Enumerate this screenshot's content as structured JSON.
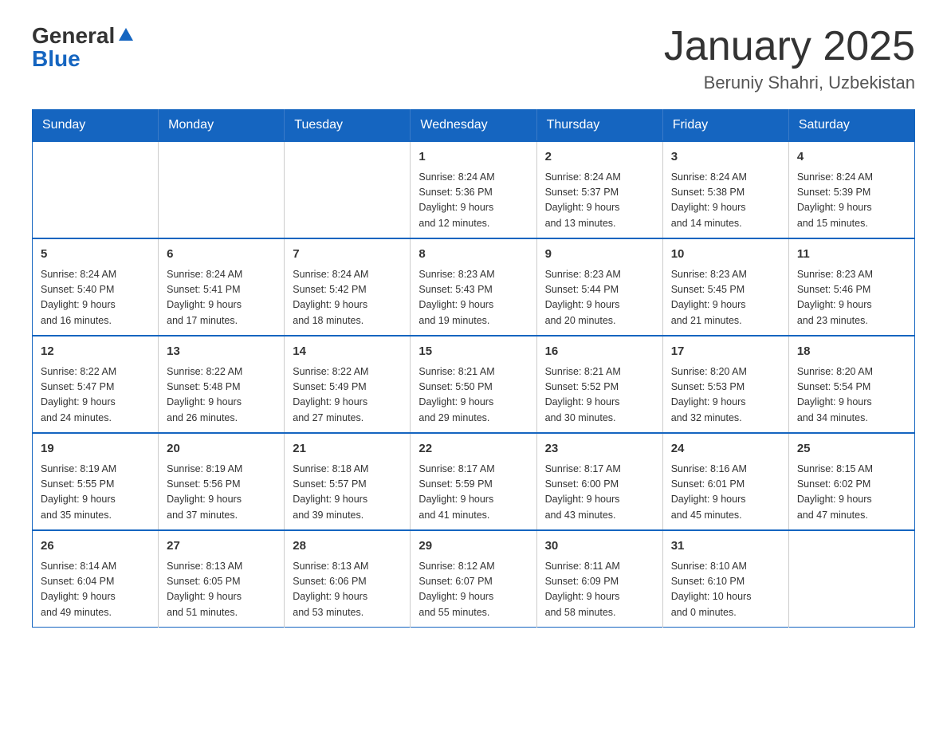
{
  "header": {
    "logo_general": "General",
    "logo_blue": "Blue",
    "title": "January 2025",
    "subtitle": "Beruniy Shahri, Uzbekistan"
  },
  "days_of_week": [
    "Sunday",
    "Monday",
    "Tuesday",
    "Wednesday",
    "Thursday",
    "Friday",
    "Saturday"
  ],
  "weeks": [
    [
      {
        "day": "",
        "info": ""
      },
      {
        "day": "",
        "info": ""
      },
      {
        "day": "",
        "info": ""
      },
      {
        "day": "1",
        "info": "Sunrise: 8:24 AM\nSunset: 5:36 PM\nDaylight: 9 hours\nand 12 minutes."
      },
      {
        "day": "2",
        "info": "Sunrise: 8:24 AM\nSunset: 5:37 PM\nDaylight: 9 hours\nand 13 minutes."
      },
      {
        "day": "3",
        "info": "Sunrise: 8:24 AM\nSunset: 5:38 PM\nDaylight: 9 hours\nand 14 minutes."
      },
      {
        "day": "4",
        "info": "Sunrise: 8:24 AM\nSunset: 5:39 PM\nDaylight: 9 hours\nand 15 minutes."
      }
    ],
    [
      {
        "day": "5",
        "info": "Sunrise: 8:24 AM\nSunset: 5:40 PM\nDaylight: 9 hours\nand 16 minutes."
      },
      {
        "day": "6",
        "info": "Sunrise: 8:24 AM\nSunset: 5:41 PM\nDaylight: 9 hours\nand 17 minutes."
      },
      {
        "day": "7",
        "info": "Sunrise: 8:24 AM\nSunset: 5:42 PM\nDaylight: 9 hours\nand 18 minutes."
      },
      {
        "day": "8",
        "info": "Sunrise: 8:23 AM\nSunset: 5:43 PM\nDaylight: 9 hours\nand 19 minutes."
      },
      {
        "day": "9",
        "info": "Sunrise: 8:23 AM\nSunset: 5:44 PM\nDaylight: 9 hours\nand 20 minutes."
      },
      {
        "day": "10",
        "info": "Sunrise: 8:23 AM\nSunset: 5:45 PM\nDaylight: 9 hours\nand 21 minutes."
      },
      {
        "day": "11",
        "info": "Sunrise: 8:23 AM\nSunset: 5:46 PM\nDaylight: 9 hours\nand 23 minutes."
      }
    ],
    [
      {
        "day": "12",
        "info": "Sunrise: 8:22 AM\nSunset: 5:47 PM\nDaylight: 9 hours\nand 24 minutes."
      },
      {
        "day": "13",
        "info": "Sunrise: 8:22 AM\nSunset: 5:48 PM\nDaylight: 9 hours\nand 26 minutes."
      },
      {
        "day": "14",
        "info": "Sunrise: 8:22 AM\nSunset: 5:49 PM\nDaylight: 9 hours\nand 27 minutes."
      },
      {
        "day": "15",
        "info": "Sunrise: 8:21 AM\nSunset: 5:50 PM\nDaylight: 9 hours\nand 29 minutes."
      },
      {
        "day": "16",
        "info": "Sunrise: 8:21 AM\nSunset: 5:52 PM\nDaylight: 9 hours\nand 30 minutes."
      },
      {
        "day": "17",
        "info": "Sunrise: 8:20 AM\nSunset: 5:53 PM\nDaylight: 9 hours\nand 32 minutes."
      },
      {
        "day": "18",
        "info": "Sunrise: 8:20 AM\nSunset: 5:54 PM\nDaylight: 9 hours\nand 34 minutes."
      }
    ],
    [
      {
        "day": "19",
        "info": "Sunrise: 8:19 AM\nSunset: 5:55 PM\nDaylight: 9 hours\nand 35 minutes."
      },
      {
        "day": "20",
        "info": "Sunrise: 8:19 AM\nSunset: 5:56 PM\nDaylight: 9 hours\nand 37 minutes."
      },
      {
        "day": "21",
        "info": "Sunrise: 8:18 AM\nSunset: 5:57 PM\nDaylight: 9 hours\nand 39 minutes."
      },
      {
        "day": "22",
        "info": "Sunrise: 8:17 AM\nSunset: 5:59 PM\nDaylight: 9 hours\nand 41 minutes."
      },
      {
        "day": "23",
        "info": "Sunrise: 8:17 AM\nSunset: 6:00 PM\nDaylight: 9 hours\nand 43 minutes."
      },
      {
        "day": "24",
        "info": "Sunrise: 8:16 AM\nSunset: 6:01 PM\nDaylight: 9 hours\nand 45 minutes."
      },
      {
        "day": "25",
        "info": "Sunrise: 8:15 AM\nSunset: 6:02 PM\nDaylight: 9 hours\nand 47 minutes."
      }
    ],
    [
      {
        "day": "26",
        "info": "Sunrise: 8:14 AM\nSunset: 6:04 PM\nDaylight: 9 hours\nand 49 minutes."
      },
      {
        "day": "27",
        "info": "Sunrise: 8:13 AM\nSunset: 6:05 PM\nDaylight: 9 hours\nand 51 minutes."
      },
      {
        "day": "28",
        "info": "Sunrise: 8:13 AM\nSunset: 6:06 PM\nDaylight: 9 hours\nand 53 minutes."
      },
      {
        "day": "29",
        "info": "Sunrise: 8:12 AM\nSunset: 6:07 PM\nDaylight: 9 hours\nand 55 minutes."
      },
      {
        "day": "30",
        "info": "Sunrise: 8:11 AM\nSunset: 6:09 PM\nDaylight: 9 hours\nand 58 minutes."
      },
      {
        "day": "31",
        "info": "Sunrise: 8:10 AM\nSunset: 6:10 PM\nDaylight: 10 hours\nand 0 minutes."
      },
      {
        "day": "",
        "info": ""
      }
    ]
  ]
}
